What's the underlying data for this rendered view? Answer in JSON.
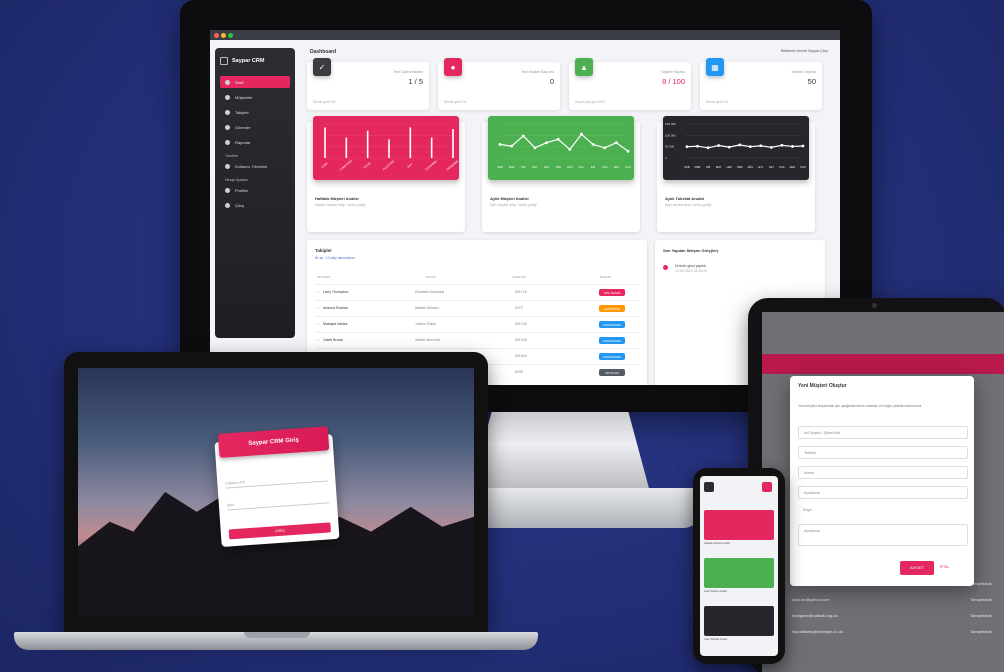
{
  "monitor": {
    "brand": "Saypar CRM",
    "nav": [
      {
        "label": "Özet",
        "active": true
      },
      {
        "label": "Müşteriler",
        "active": false
      },
      {
        "label": "Takipler",
        "active": false
      },
      {
        "label": "Görevler",
        "active": false
      },
      {
        "label": "Raporlar",
        "active": false
      }
    ],
    "nav_section_1": "Yönetim",
    "nav_item_users": "Kullanıcı Yönetimi",
    "nav_section_2": "Hesap Ayarları",
    "nav_item_profile": "Profilim",
    "nav_item_logout": "Çıkış",
    "page_title": "Dashboard",
    "user_bar": "Bildirimler  Ahmet Saypar  Çıkış",
    "stats": [
      {
        "label": "Yeni Çalma Baştan",
        "value": "1 / 5",
        "footer": "Dünde göre 0%",
        "color": "#3a3c42",
        "icon": "check-icon"
      },
      {
        "label": "Yeni Müşteri Başvuru",
        "value": "0",
        "footer": "Dünde göre 0%",
        "color": "#e4275f",
        "icon": "user-icon"
      },
      {
        "label": "Toplam Kayıtlar",
        "value": "8 / 100",
        "footer": "Geçen yıla göre 20%",
        "color": "#4caf50",
        "icon": "chart-icon"
      },
      {
        "label": "Tahmini Kaşıtlar",
        "value": "50",
        "footer": "Dünde göre 0%",
        "color": "#2196f3",
        "icon": "calendar-icon"
      }
    ],
    "charts": [
      {
        "title": "Haftalık Müşteri Analizi",
        "sub": "Haftalık müşteri artışı / azalış grafiği",
        "color": "#e4275f",
        "categories": [
          "CUMA",
          "CUMARTESİ",
          "PAZAR",
          "PAZARTESİ",
          "SALI",
          "ÇARŞAMBA",
          "PERŞEMBE"
        ],
        "values": [
          90,
          60,
          80,
          55,
          90,
          60,
          85
        ]
      },
      {
        "title": "Aylık Müşteri Analizi",
        "sub": "Aylık müşteri artışı / azalış grafiği",
        "color": "#4caf50",
        "categories": [
          "ŞUB",
          "MAR",
          "NİS",
          "MAY",
          "HAZ",
          "TEM",
          "AĞU",
          "EYL",
          "EKİ",
          "KAS",
          "ARA",
          "OCA"
        ],
        "values": [
          40,
          35,
          65,
          30,
          45,
          55,
          25,
          70,
          40,
          30,
          45,
          20
        ]
      },
      {
        "title": "Aylık Tahsilat Analizi",
        "sub": "Aylık tahsilat artışı / azalış grafiği",
        "color": "#26272c",
        "categories": [
          "ŞUB",
          "MAR",
          "NİS",
          "MAY",
          "HAZ",
          "TEM",
          "AĞU",
          "EYL",
          "EKİ",
          "KAS",
          "ARA",
          "OCA"
        ],
        "values": [
          50000,
          52000,
          45000,
          55000,
          48000,
          58000,
          50000,
          54000,
          47000,
          56000,
          51000,
          53000
        ],
        "yticks": [
          "150.000",
          "100.000",
          "50.000",
          "0"
        ]
      }
    ],
    "tasks": {
      "title": "Takipler",
      "subtitle": "Bu ay : 12 takip tamamlandı",
      "headers": [
        "MÜŞTERİ",
        "YETKİLİ",
        "TELEFON",
        "DURUM"
      ],
      "rows": [
        {
          "name": "Larry Thompson",
          "contact": "Elizabeth Brandine",
          "phone": "661718",
          "status": "YENİ ARAMA",
          "color": "#e4275f"
        },
        {
          "name": "Arianna Rodcan",
          "contact": "Natalie Whalan",
          "phone": "6372",
          "status": "ÇEVRİMDIŞI",
          "color": "#ff9800"
        },
        {
          "name": "Makayla Valdez",
          "contact": "Juliane Raldo",
          "phone": "561748",
          "status": "TAMAMLANDI",
          "color": "#2196f3"
        },
        {
          "name": "Caleb Brown",
          "contact": "Walker Burchins",
          "phone": "661028",
          "status": "TAMAMLANDI",
          "color": "#2196f3"
        },
        {
          "name": "",
          "contact": "",
          "phone": "651649",
          "status": "TAMAMLANDI",
          "color": "#2196f3"
        },
        {
          "name": "",
          "contact": "",
          "phone": "6038",
          "status": "ÖRTÜLDÜ",
          "color": "#555b66"
        }
      ]
    },
    "notifications": {
      "title": "Son Yapılan İletişim Giriş(ler)",
      "item_title": "Ürünün girişi yapıldı.",
      "item_date": "23.09.2022 16:05:24"
    }
  },
  "laptop": {
    "login_title": "Saypar CRM Giriş",
    "username_placeholder": "Kullanıcı Adı",
    "password_placeholder": "Şifre",
    "login_button": "GİRİŞ"
  },
  "tablet": {
    "modal_title": "Yeni Müşteri Oluştur",
    "modal_desc": "Yeni müşteri oluşturmak için aşağıdaki formu eksiksiz ve doğru şekilde doldurunuz.",
    "fields": [
      "Ad Soyad / Şirket Adı",
      "Telefon",
      "Adres",
      "Açıklama",
      "Kayıt",
      "Açıklama"
    ],
    "save": "KAYDET",
    "cancel": "İPTAL",
    "rows": [
      {
        "email": "orem.holloway@gmail.com",
        "status": "Tamamlandı"
      },
      {
        "email": "kara.lev@yahoo.com",
        "status": "Tamamlandı"
      },
      {
        "email": "tedriguez@outlook.org.uk",
        "status": "Tamamlandı"
      },
      {
        "email": "lisa.williams@example.co.uk",
        "status": "Tamamlandı"
      }
    ]
  }
}
